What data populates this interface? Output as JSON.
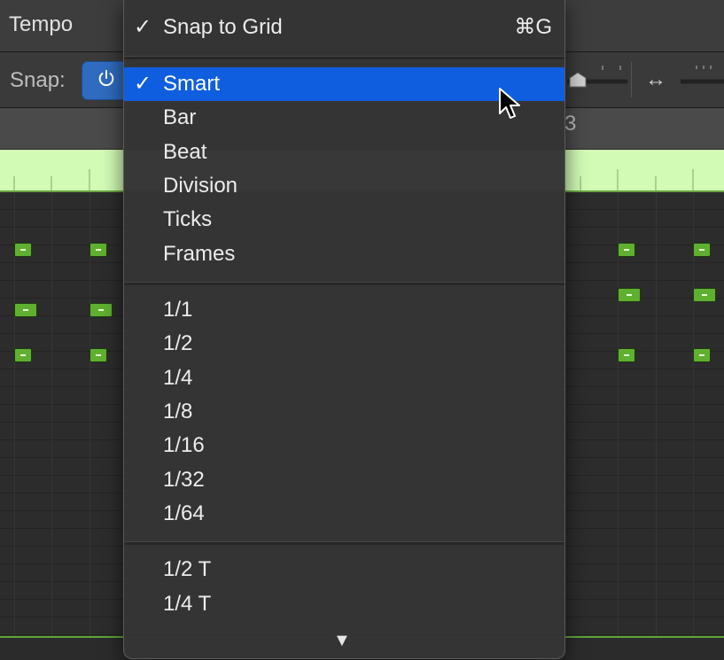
{
  "toolbar": {
    "tempo_label": "Tempo",
    "snap_label": "Snap:",
    "snap_toggle_icon": "power-icon",
    "width_icon": "↔"
  },
  "ruler": {
    "bar_number": "3"
  },
  "menu": {
    "header": {
      "check": "✓",
      "label": "Snap to Grid",
      "shortcut": "⌘G"
    },
    "mode_items": [
      {
        "check": "✓",
        "label": "Smart",
        "selected": true
      },
      {
        "check": "",
        "label": "Bar"
      },
      {
        "check": "",
        "label": "Beat"
      },
      {
        "check": "",
        "label": "Division"
      },
      {
        "check": "",
        "label": "Ticks"
      },
      {
        "check": "",
        "label": "Frames"
      }
    ],
    "value_items": [
      {
        "label": "1/1"
      },
      {
        "label": "1/2"
      },
      {
        "label": "1/4"
      },
      {
        "label": "1/8"
      },
      {
        "label": "1/16"
      },
      {
        "label": "1/32"
      },
      {
        "label": "1/64"
      }
    ],
    "triplet_items": [
      {
        "label": "1/2 T"
      },
      {
        "label": "1/4 T"
      }
    ],
    "scroll_indicator": "▼"
  },
  "colors": {
    "menu_highlight": "#0f5ee0",
    "snap_toggle": "#2f6bbf",
    "region": "#d2fbb6",
    "note": "#5fb030"
  }
}
